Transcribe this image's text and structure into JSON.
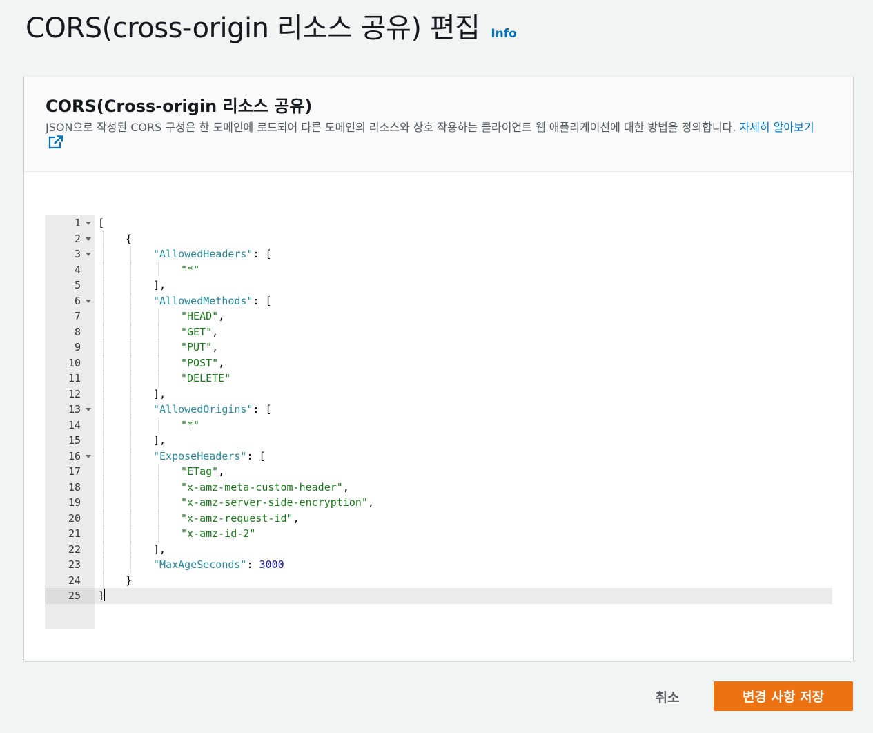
{
  "page": {
    "title": "CORS(cross-origin 리소스 공유) 편집",
    "info_label": "Info"
  },
  "panel": {
    "title": "CORS(Cross-origin 리소스 공유)",
    "description": "JSON으로 작성된 CORS 구성은 한 도메인에 로드되어 다른 도메인의 리소스와 상호 작용하는 클라이언트 웹 애플리케이션에 대한 방법을 정의합니다.",
    "learn_more": "자세히 알아보기"
  },
  "editor": {
    "language": "json",
    "active_line": 25,
    "lines": [
      {
        "n": "1",
        "indent": 0,
        "fold": true,
        "tokens": [
          [
            "p",
            "["
          ]
        ]
      },
      {
        "n": "2",
        "indent": 1,
        "fold": true,
        "tokens": [
          [
            "p",
            "{"
          ]
        ]
      },
      {
        "n": "3",
        "indent": 2,
        "fold": true,
        "tokens": [
          [
            "k",
            "\"AllowedHeaders\""
          ],
          [
            "p",
            ": ["
          ]
        ]
      },
      {
        "n": "4",
        "indent": 3,
        "fold": false,
        "tokens": [
          [
            "s",
            "\"*\""
          ]
        ]
      },
      {
        "n": "5",
        "indent": 2,
        "fold": false,
        "tokens": [
          [
            "p",
            "],"
          ]
        ]
      },
      {
        "n": "6",
        "indent": 2,
        "fold": true,
        "tokens": [
          [
            "k",
            "\"AllowedMethods\""
          ],
          [
            "p",
            ": ["
          ]
        ]
      },
      {
        "n": "7",
        "indent": 3,
        "fold": false,
        "tokens": [
          [
            "s",
            "\"HEAD\""
          ],
          [
            "p",
            ","
          ]
        ]
      },
      {
        "n": "8",
        "indent": 3,
        "fold": false,
        "tokens": [
          [
            "s",
            "\"GET\""
          ],
          [
            "p",
            ","
          ]
        ]
      },
      {
        "n": "9",
        "indent": 3,
        "fold": false,
        "tokens": [
          [
            "s",
            "\"PUT\""
          ],
          [
            "p",
            ","
          ]
        ]
      },
      {
        "n": "10",
        "indent": 3,
        "fold": false,
        "tokens": [
          [
            "s",
            "\"POST\""
          ],
          [
            "p",
            ","
          ]
        ]
      },
      {
        "n": "11",
        "indent": 3,
        "fold": false,
        "tokens": [
          [
            "s",
            "\"DELETE\""
          ]
        ]
      },
      {
        "n": "12",
        "indent": 2,
        "fold": false,
        "tokens": [
          [
            "p",
            "],"
          ]
        ]
      },
      {
        "n": "13",
        "indent": 2,
        "fold": true,
        "tokens": [
          [
            "k",
            "\"AllowedOrigins\""
          ],
          [
            "p",
            ": ["
          ]
        ]
      },
      {
        "n": "14",
        "indent": 3,
        "fold": false,
        "tokens": [
          [
            "s",
            "\"*\""
          ]
        ]
      },
      {
        "n": "15",
        "indent": 2,
        "fold": false,
        "tokens": [
          [
            "p",
            "],"
          ]
        ]
      },
      {
        "n": "16",
        "indent": 2,
        "fold": true,
        "tokens": [
          [
            "k",
            "\"ExposeHeaders\""
          ],
          [
            "p",
            ": ["
          ]
        ]
      },
      {
        "n": "17",
        "indent": 3,
        "fold": false,
        "tokens": [
          [
            "s",
            "\"ETag\""
          ],
          [
            "p",
            ","
          ]
        ]
      },
      {
        "n": "18",
        "indent": 3,
        "fold": false,
        "tokens": [
          [
            "s",
            "\"x-amz-meta-custom-header\""
          ],
          [
            "p",
            ","
          ]
        ]
      },
      {
        "n": "19",
        "indent": 3,
        "fold": false,
        "tokens": [
          [
            "s",
            "\"x-amz-server-side-encryption\""
          ],
          [
            "p",
            ","
          ]
        ]
      },
      {
        "n": "20",
        "indent": 3,
        "fold": false,
        "tokens": [
          [
            "s",
            "\"x-amz-request-id\""
          ],
          [
            "p",
            ","
          ]
        ]
      },
      {
        "n": "21",
        "indent": 3,
        "fold": false,
        "tokens": [
          [
            "s",
            "\"x-amz-id-2\""
          ]
        ]
      },
      {
        "n": "22",
        "indent": 2,
        "fold": false,
        "tokens": [
          [
            "p",
            "],"
          ]
        ]
      },
      {
        "n": "23",
        "indent": 2,
        "fold": false,
        "tokens": [
          [
            "k",
            "\"MaxAgeSeconds\""
          ],
          [
            "p",
            ": "
          ],
          [
            "n",
            "3000"
          ]
        ]
      },
      {
        "n": "24",
        "indent": 1,
        "fold": false,
        "tokens": [
          [
            "p",
            "}"
          ]
        ]
      },
      {
        "n": "25",
        "indent": 0,
        "fold": false,
        "tokens": [
          [
            "p",
            "]"
          ]
        ]
      }
    ]
  },
  "actions": {
    "cancel_label": "취소",
    "save_label": "변경 사항 저장"
  },
  "colors": {
    "accent": "#ec7211",
    "link": "#0073bb",
    "json_key": "#2a8a9a",
    "json_string": "#1a7a1a",
    "json_number": "#1a1aa6"
  }
}
